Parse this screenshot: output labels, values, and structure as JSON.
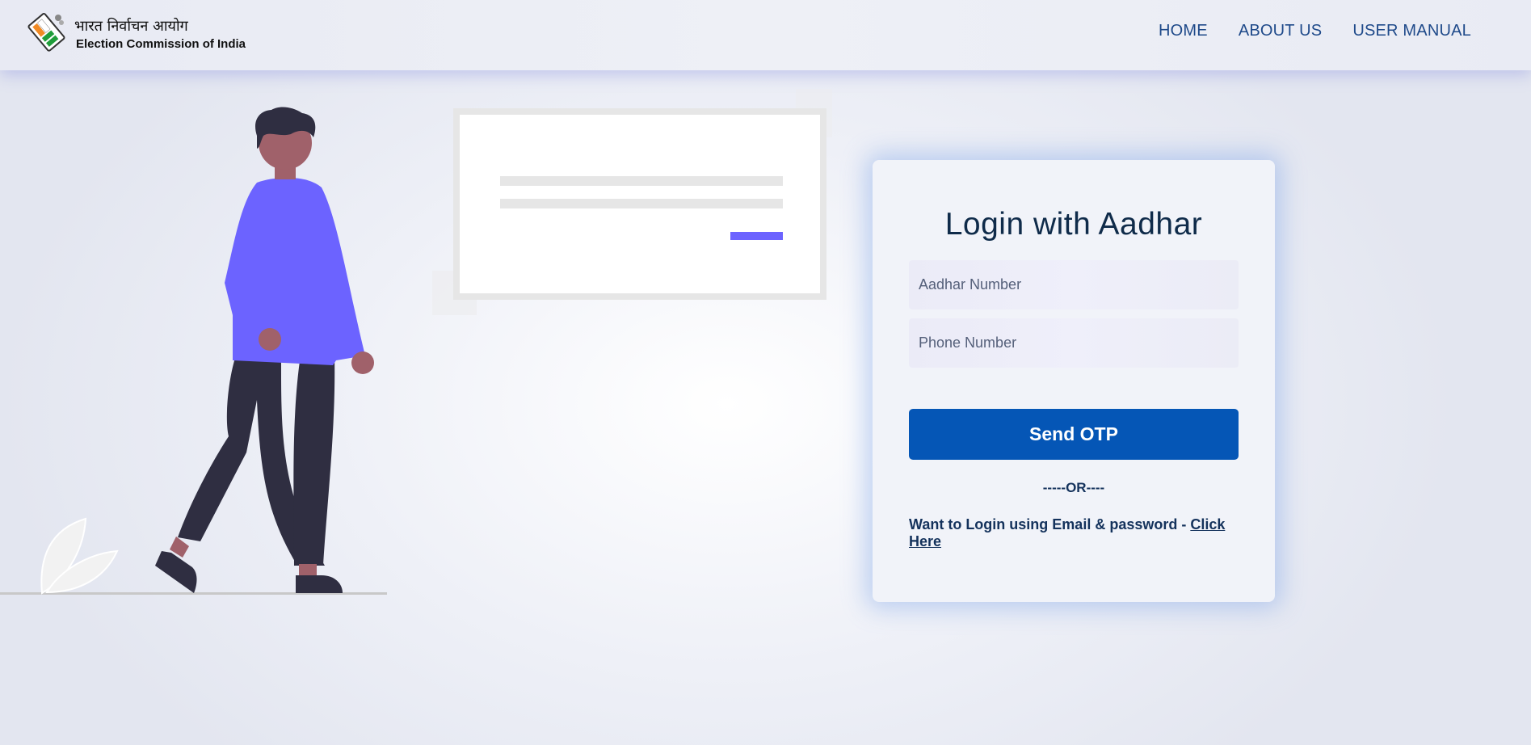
{
  "header": {
    "brand_hindi": "भारत निर्वाचन आयोग",
    "brand_english": "Election Commission of India",
    "nav": [
      "HOME",
      "ABOUT US",
      "USER MANUAL"
    ]
  },
  "login": {
    "title": "Login with Aadhar",
    "aadhar_placeholder": "Aadhar Number",
    "phone_placeholder": "Phone Number",
    "send_otp_label": "Send OTP",
    "or_text": "-----OR----",
    "alt_prefix": "Want to Login using Email & password - ",
    "alt_link": "Click Here"
  },
  "colors": {
    "primary": "#0556b6",
    "text_dark": "#14325c",
    "illustration_accent": "#6c63ff"
  }
}
